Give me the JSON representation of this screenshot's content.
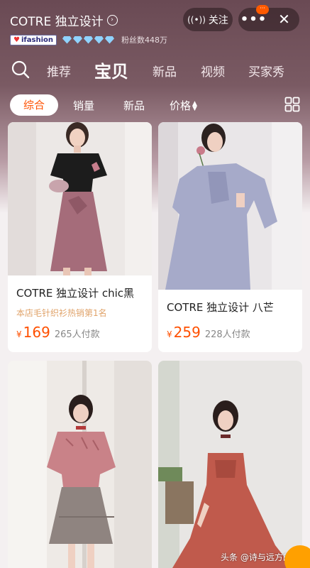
{
  "header": {
    "shop_name": "COTRE 独立设计",
    "badge": "ifashion",
    "fans": "粉丝数448万",
    "follow_label": "关注",
    "more_label": "•••",
    "close_label": "✕"
  },
  "nav": {
    "tabs": [
      "推荐",
      "宝贝",
      "新品",
      "视频",
      "买家秀"
    ],
    "active_tab": "宝贝"
  },
  "filter": {
    "items": [
      "综合",
      "销量",
      "新品",
      "价格"
    ],
    "active": "综合"
  },
  "products": [
    {
      "title": "COTRE 独立设计 chic黑",
      "subtitle": "本店毛针织衫热销第1名",
      "currency": "¥",
      "price": "169",
      "sold": "265人付款"
    },
    {
      "title": "COTRE 独立设计 八芒",
      "subtitle": "",
      "currency": "¥",
      "price": "259",
      "sold": "228人付款"
    }
  ],
  "watermark": "头条 @诗与远方的骗子",
  "colors": {
    "accent": "#ff5000",
    "header_bg": "#6a4a54"
  }
}
